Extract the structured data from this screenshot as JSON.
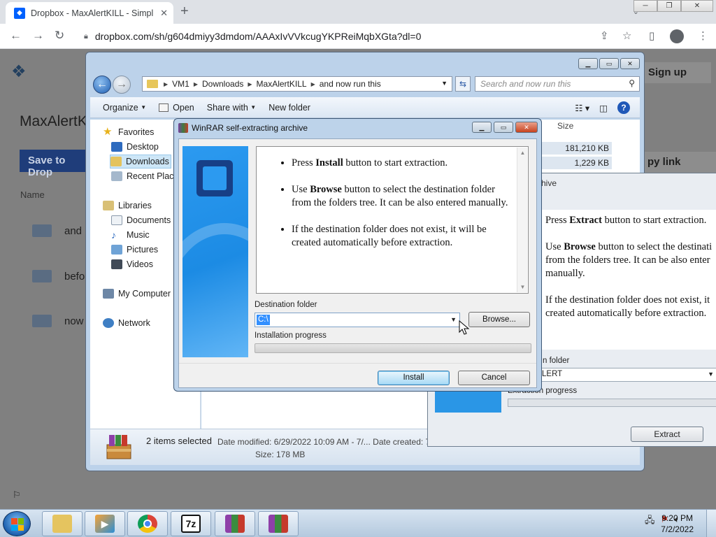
{
  "browser": {
    "tab_title": "Dropbox - MaxAlertKILL - Simpl",
    "tab_favicon": "dropbox-icon",
    "tab_close": "✕",
    "new_tab": "+",
    "url": "dropbox.com/sh/g604dmiyy3dmdom/AAAxIvVVkcugYKPReiMqbXGta?dl=0"
  },
  "dropbox": {
    "page_title": "MaxAlertKi",
    "save_button": "Save to Drop",
    "sign_up": "Sign up",
    "copy_link": "py link",
    "name_header": "Name",
    "items": [
      "and",
      "befo",
      "now"
    ]
  },
  "explorer": {
    "breadcrumb": [
      "VM1",
      "Downloads",
      "MaxAlertKILL",
      "and now run this"
    ],
    "search_placeholder": "Search and now run this",
    "commands": {
      "organize": "Organize",
      "open": "Open",
      "share": "Share with",
      "new_folder": "New folder"
    },
    "nav": {
      "favorites": "Favorites",
      "desktop": "Desktop",
      "downloads": "Downloads",
      "recent": "Recent Places",
      "libraries": "Libraries",
      "documents": "Documents",
      "music": "Music",
      "pictures": "Pictures",
      "videos": "Videos",
      "computer": "My Computer",
      "network": "Network"
    },
    "size_header": "Size",
    "sizes": [
      "181,210 KB",
      "1,229 KB"
    ],
    "status": {
      "selected": "2 items selected",
      "modified": "Date modified: 6/29/2022 10:09 AM - 7/...",
      "created": "Date created: 7",
      "size": "Size: 178 MB"
    }
  },
  "winrar_bg": {
    "title_fragment": "hive",
    "line1_pre": "Press ",
    "line1_bold": "Extract",
    "line1_post": " button to start extraction.",
    "line2_pre": "Use ",
    "line2_bold": "Browse",
    "line2_post": " button to select the destinati from the folders tree. It can be also enter manually.",
    "line3": "If the destination folder does not exist, it created automatically before extraction.",
    "dest_label": "n folder",
    "dest_value": "LERT",
    "progress_label": "Extraction progress",
    "extract_button": "Extract"
  },
  "winrar": {
    "title": "WinRAR self-extracting archive",
    "bullet1_pre": "Press ",
    "bullet1_bold": "Install",
    "bullet1_post": " button to start extraction.",
    "bullet2_pre": "Use ",
    "bullet2_bold": "Browse",
    "bullet2_post": " button to select the destination folder from the folders tree. It can be also entered manually.",
    "bullet3": "If the destination folder does not exist, it will be created automatically before extraction.",
    "dest_label": "Destination folder",
    "dest_value": "C:\\",
    "browse_button": "Browse...",
    "progress_label": "Installation progress",
    "progress": 0,
    "install_button": "Install",
    "cancel_button": "Cancel"
  },
  "taskbar": {
    "apps": [
      "explorer",
      "media-player",
      "chrome",
      "7-zip",
      "winrar",
      "winrar"
    ],
    "sevenzip_label": "7z",
    "time": "9:20 PM",
    "date": "7/2/2022"
  }
}
